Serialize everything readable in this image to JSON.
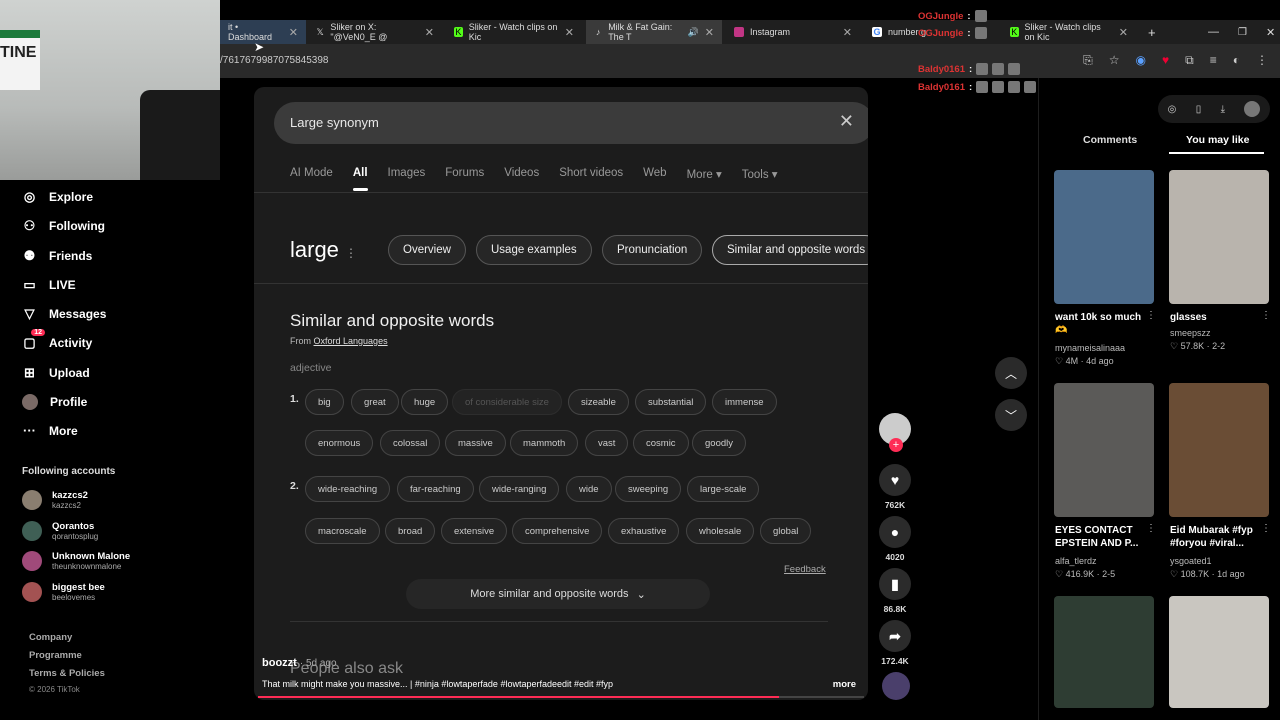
{
  "webcam": {
    "sign_text": "TINE"
  },
  "browser": {
    "tabs": [
      {
        "label": "it • Dashboard",
        "favicon": "dashboard-icon"
      },
      {
        "label": "Sliker on X: \"@VeN0_E @",
        "favicon": "x-icon"
      },
      {
        "label": "Sliker - Watch clips on Kic",
        "favicon": "kick-icon"
      },
      {
        "label": "Milk & Fat Gain: The T",
        "favicon": "tiktok-icon"
      },
      {
        "label": "Instagram",
        "favicon": "instagram-icon"
      },
      {
        "label": "number g",
        "favicon": "google-icon"
      },
      {
        "label": "Sliker - Watch clips on Kic",
        "favicon": "kick-icon"
      }
    ],
    "url": "/7617679987075845398"
  },
  "sidebar": {
    "nav": [
      {
        "label": "Explore",
        "icon": "compass-icon"
      },
      {
        "label": "Following",
        "icon": "following-icon"
      },
      {
        "label": "Friends",
        "icon": "friends-icon"
      },
      {
        "label": "LIVE",
        "icon": "live-icon"
      },
      {
        "label": "Messages",
        "icon": "messages-icon"
      },
      {
        "label": "Activity",
        "icon": "activity-icon",
        "badge": "12"
      },
      {
        "label": "Upload",
        "icon": "upload-icon"
      },
      {
        "label": "Profile",
        "icon": "avatar"
      },
      {
        "label": "More",
        "icon": "more-icon"
      }
    ],
    "following_title": "Following accounts",
    "accounts": [
      {
        "name": "kazzcs2",
        "handle": "kazzcs2"
      },
      {
        "name": "Qorantos",
        "handle": "qorantosplug"
      },
      {
        "name": "Unknown Malone",
        "handle": "theunknownmalone"
      },
      {
        "name": "biggest bee",
        "handle": "beelovemes"
      }
    ],
    "footer": [
      "Company",
      "Programme",
      "Terms & Policies"
    ],
    "copyright": "© 2026 TikTok"
  },
  "video": {
    "search_query": "Large synonym",
    "google_tabs": [
      "AI Mode",
      "All",
      "Images",
      "Forums",
      "Videos",
      "Short videos",
      "Web",
      "More ▾",
      "Tools ▾"
    ],
    "word": "large",
    "pills": [
      "Overview",
      "Usage examples",
      "Pronunciation",
      "Similar and opposite words"
    ],
    "heading": "Similar and opposite words",
    "source_prefix": "From",
    "source": "Oxford Languages",
    "pos": "adjective",
    "sense1_num": "1.",
    "sense1_row1": [
      "big",
      "great",
      "huge",
      "of considerable size",
      "sizeable",
      "substantial",
      "immense"
    ],
    "sense1_row2": [
      "enormous",
      "colossal",
      "massive",
      "mammoth",
      "vast",
      "cosmic",
      "goodly"
    ],
    "sense2_num": "2.",
    "sense2_row1": [
      "wide-reaching",
      "far-reaching",
      "wide-ranging",
      "wide",
      "sweeping",
      "large-scale"
    ],
    "sense2_row2": [
      "macroscale",
      "broad",
      "extensive",
      "comprehensive",
      "exhaustive",
      "wholesale",
      "global"
    ],
    "feedback": "Feedback",
    "more_words": "More similar and opposite words",
    "people_also_ask": "People also ask",
    "author": "boozzt",
    "age": "· 5d ago",
    "caption": "That milk might make you massive... | #ninja #lowtaperfade #lowtaperfadeedit #edit #fyp",
    "more": "more",
    "progress": 0.86
  },
  "actions": {
    "likes": "762K",
    "comments": "4020",
    "saves": "86.8K",
    "shares": "172.4K"
  },
  "chat": [
    {
      "user": "OGJungle",
      "mark": ":"
    },
    {
      "user": "OGJungle",
      "mark": ":"
    },
    {
      "user": "Baldy0161",
      "mark": ":"
    },
    {
      "user": "Baldy0161",
      "mark": ":"
    }
  ],
  "right_panel": {
    "tabs": [
      "Comments",
      "You may like"
    ],
    "cards": [
      {
        "title": "want 10k so much 🫶",
        "author": "mynameisalinaaa",
        "stats": "♡ 4M · 4d ago",
        "color": "#4b6a8a"
      },
      {
        "title": "glasses",
        "author": "smeepszz",
        "stats": "♡ 57.8K · 2-2",
        "color": "#b9b4ad"
      },
      {
        "title": "EYES CONTACT EPSTEIN AND P...",
        "author": "alfa_tlerdz",
        "stats": "♡ 416.9K · 2-5",
        "color": "#5b5a58"
      },
      {
        "title": "Eid Mubarak #fyp #foryou #viral...",
        "author": "ysgoated1",
        "stats": "♡ 108.7K · 1d ago",
        "color": "#6a4d35"
      },
      {
        "title": "",
        "author": "",
        "stats": "",
        "color": "#2e3d33"
      },
      {
        "title": "",
        "author": "",
        "stats": "",
        "color": "#c9c6c0"
      }
    ]
  }
}
